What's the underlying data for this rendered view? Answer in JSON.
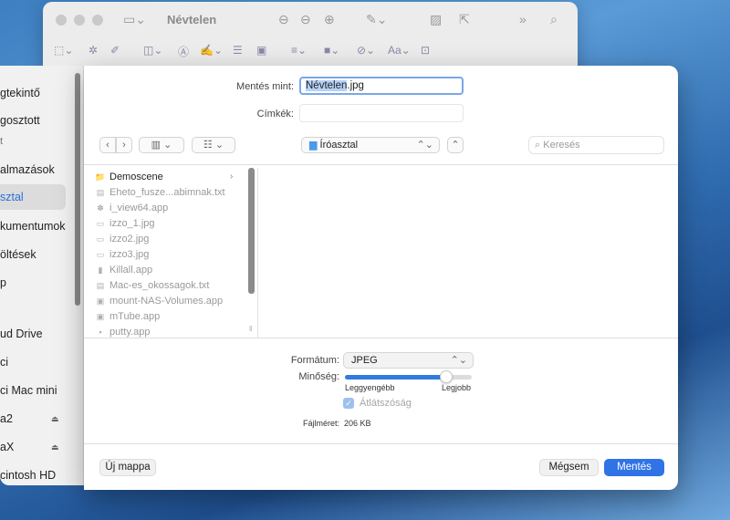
{
  "back_window": {
    "title": "Névtelen"
  },
  "sidebar": {
    "items": [
      {
        "label": "gtekintő"
      },
      {
        "label": "gosztott"
      },
      {
        "label": "almazások"
      },
      {
        "label": "sztal",
        "active": true
      },
      {
        "label": "kumentumok"
      },
      {
        "label": "öltések"
      },
      {
        "label": "p"
      },
      {
        "label": "ud Drive"
      },
      {
        "label": "ci"
      },
      {
        "label": "ci Mac mini"
      },
      {
        "label": "a2",
        "eject": true
      },
      {
        "label": "aX",
        "eject": true
      },
      {
        "label": "cintosh HD"
      }
    ],
    "section_fragment": "t"
  },
  "dialog": {
    "save_as_label": "Mentés mint:",
    "save_as_selected": "Névtelen",
    "save_as_rest": ".jpg",
    "tags_label": "Címkék:",
    "nav_back": "‹",
    "nav_fwd": "›",
    "view_columns": "▥ ⌄",
    "view_grid": "☷ ⌄",
    "location": "Íróasztal",
    "location_chevron": "⌃⌄",
    "expand": "⌃",
    "search_placeholder": "Keresés",
    "files": [
      {
        "name": "Demoscene",
        "type": "folder",
        "icon": "📁"
      },
      {
        "name": "Eheto_fusze...abimnak.txt",
        "type": "file",
        "icon": "▤"
      },
      {
        "name": "i_view64.app",
        "type": "file",
        "icon": "✽"
      },
      {
        "name": "izzo_1.jpg",
        "type": "file",
        "icon": "▭"
      },
      {
        "name": "izzo2.jpg",
        "type": "file",
        "icon": "▭"
      },
      {
        "name": "izzo3.jpg",
        "type": "file",
        "icon": "▭"
      },
      {
        "name": "Killall.app",
        "type": "file",
        "icon": "▮"
      },
      {
        "name": "Mac-es_okossagok.txt",
        "type": "file",
        "icon": "▤"
      },
      {
        "name": "mount-NAS-Volumes.app",
        "type": "file",
        "icon": "▣"
      },
      {
        "name": "mTube.app",
        "type": "file",
        "icon": "▣"
      },
      {
        "name": "putty.app",
        "type": "file",
        "icon": "▪"
      }
    ],
    "format_label": "Formátum:",
    "format_value": "JPEG",
    "quality_label": "Minőség:",
    "quality_level": 0.8,
    "quality_min": "Leggyengébb",
    "quality_max": "Legjobb",
    "alpha_label": "Átlátszóság",
    "filesize_label": "Fájlméret:",
    "filesize_value": "206 KB",
    "new_folder": "Új mappa",
    "cancel": "Mégsem",
    "save": "Mentés"
  },
  "colors": {
    "accent": "#2f73e6",
    "selection": "#b7d2f7"
  }
}
